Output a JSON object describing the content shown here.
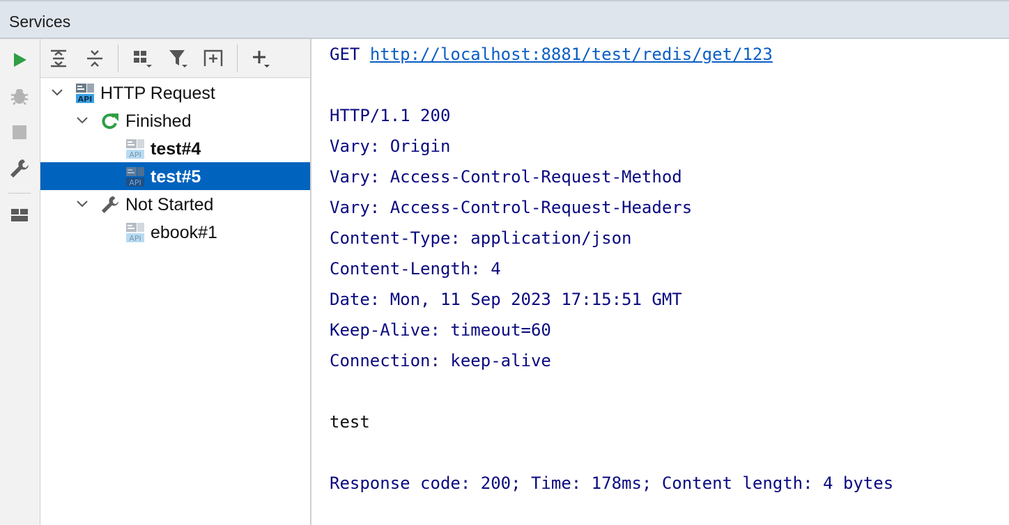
{
  "window": {
    "title": "Services"
  },
  "left_strip": {
    "buttons": [
      {
        "name": "run-icon",
        "color": "#2f9e44"
      },
      {
        "name": "debug-icon",
        "color": "#a9a9a9"
      },
      {
        "name": "stop-icon",
        "color": "#b5b5b5"
      },
      {
        "name": "wrench-icon",
        "color": "#5e5e5e"
      },
      {
        "name": "layout-icon",
        "color": "#5e5e5e"
      }
    ]
  },
  "toolbar": {
    "buttons": [
      "expand-all-icon",
      "collapse-all-icon",
      "group-by-icon",
      "filter-icon",
      "new-service-icon",
      "add-icon"
    ]
  },
  "tree": {
    "root": {
      "label": "HTTP Request"
    },
    "finished": {
      "label": "Finished"
    },
    "items_finished": [
      {
        "label": "test#4",
        "selected": false
      },
      {
        "label": "test#5",
        "selected": true
      }
    ],
    "not_started": {
      "label": "Not Started"
    },
    "items_not_started": [
      {
        "label": "ebook#1"
      }
    ],
    "selection_color": "#0063bd"
  },
  "response": {
    "method": "GET",
    "url": "http://localhost:8881/test/redis/get/123",
    "status_line": "HTTP/1.1 200",
    "headers": [
      "Vary: Origin",
      "Vary: Access-Control-Request-Method",
      "Vary: Access-Control-Request-Headers",
      "Content-Type: application/json",
      "Content-Length: 4",
      "Date: Mon, 11 Sep 2023 17:15:51 GMT",
      "Keep-Alive: timeout=60",
      "Connection: keep-alive"
    ],
    "body": "test",
    "summary": "Response code: 200; Time: 178ms; Content length: 4 bytes"
  }
}
